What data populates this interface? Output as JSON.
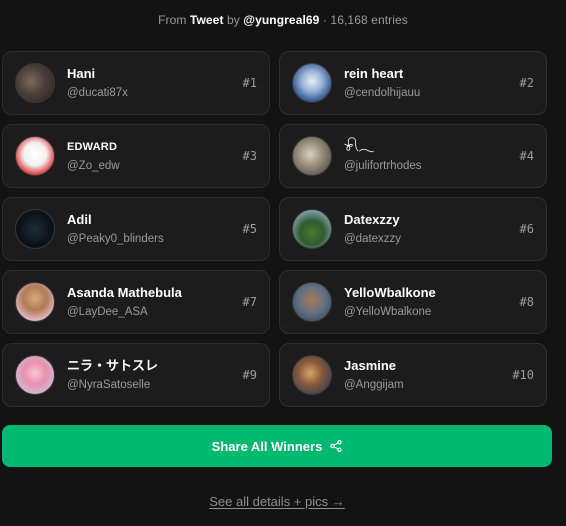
{
  "header": {
    "from_label": "From",
    "source": "Tweet",
    "by_label": "by",
    "author": "@yungreal69",
    "entries": "· 16,168 entries"
  },
  "winners": [
    {
      "rank": "#1",
      "name": "Hani",
      "handle": "@ducati87x",
      "avatar_icon": "person-icon"
    },
    {
      "rank": "#2",
      "name": "rein heart",
      "handle": "@cendolhijauu",
      "avatar_icon": "person-icon"
    },
    {
      "rank": "#3",
      "name": "EDWARD",
      "handle": "@Zo_edw",
      "avatar_icon": "person-icon"
    },
    {
      "rank": "#4",
      "name": "𓍯𓂃",
      "handle": "@julifortrhodes",
      "avatar_icon": "person-icon"
    },
    {
      "rank": "#5",
      "name": "Adil",
      "handle": "@Peaky0_blinders",
      "avatar_icon": "person-icon"
    },
    {
      "rank": "#6",
      "name": "Datexzzy",
      "handle": "@datexzzy",
      "avatar_icon": "person-icon"
    },
    {
      "rank": "#7",
      "name": "Asanda Mathebula",
      "handle": "@LayDee_ASA",
      "avatar_icon": "person-icon"
    },
    {
      "rank": "#8",
      "name": "YelloWbalkone",
      "handle": "@YelloWbalkone",
      "avatar_icon": "person-icon"
    },
    {
      "rank": "#9",
      "name": "ニラ・サトスレ",
      "handle": "@NyraSatoselle",
      "avatar_icon": "person-icon"
    },
    {
      "rank": "#10",
      "name": "Jasmine",
      "handle": "@Anggijam",
      "avatar_icon": "person-icon"
    }
  ],
  "share_button": {
    "label": "Share All Winners",
    "icon": "share-icon"
  },
  "details_link": {
    "label": "See all details + pics →"
  },
  "colors": {
    "background": "#131313",
    "card": "#1c1c1c",
    "accent": "#00b86f"
  }
}
